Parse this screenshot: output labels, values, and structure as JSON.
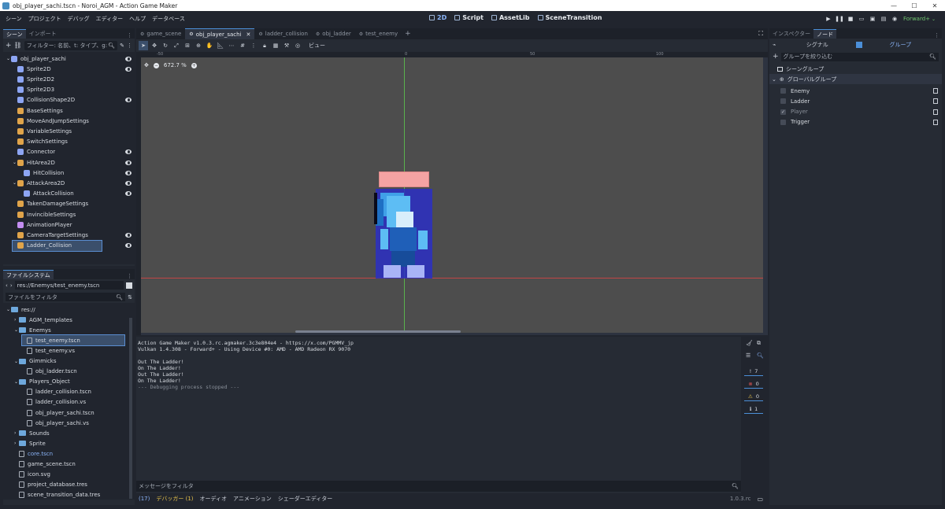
{
  "window": {
    "title": "obj_player_sachi.tscn - Noroi_AGM - Action Game Maker",
    "controls": [
      "—",
      "☐",
      "✕"
    ]
  },
  "menu": [
    "シーン",
    "プロジェクト",
    "デバッグ",
    "エディター",
    "ヘルプ",
    "データベース"
  ],
  "main_tabs": [
    {
      "label": "2D",
      "active": true
    },
    {
      "label": "Script",
      "active": false
    },
    {
      "label": "AssetLib",
      "active": false
    },
    {
      "label": "SceneTransition",
      "active": false
    }
  ],
  "renderer": "Forward+",
  "scene_dock": {
    "tabs": [
      "シーン",
      "インポート"
    ],
    "filter_placeholder": "フィルター: 名前、t: タイプ、g: グ",
    "nodes": [
      {
        "label": "obj_player_sachi",
        "depth": 0,
        "color": "#8da5f3",
        "eye": true,
        "root": true
      },
      {
        "label": "Sprite2D",
        "depth": 1,
        "color": "#8da5f3",
        "eye": true
      },
      {
        "label": "Sprite2D2",
        "depth": 1,
        "color": "#8da5f3",
        "eye": false
      },
      {
        "label": "Sprite2D3",
        "depth": 1,
        "color": "#8da5f3",
        "eye": false
      },
      {
        "label": "CollisionShape2D",
        "depth": 1,
        "color": "#8da5f3",
        "eye": true
      },
      {
        "label": "BaseSettings",
        "depth": 1,
        "color": "#e0a44a",
        "eye": false
      },
      {
        "label": "MoveAndJumpSettings",
        "depth": 1,
        "color": "#e0a44a",
        "eye": false
      },
      {
        "label": "VariableSettings",
        "depth": 1,
        "color": "#e0a44a",
        "eye": false
      },
      {
        "label": "SwitchSettings",
        "depth": 1,
        "color": "#e0a44a",
        "eye": false
      },
      {
        "label": "Connector",
        "depth": 1,
        "color": "#8da5f3",
        "eye": true
      },
      {
        "label": "HitArea2D",
        "depth": 1,
        "color": "#e0a44a",
        "eye": true
      },
      {
        "label": "HitCollision",
        "depth": 2,
        "color": "#8da5f3",
        "eye": true
      },
      {
        "label": "AttackArea2D",
        "depth": 1,
        "color": "#e0a44a",
        "eye": true
      },
      {
        "label": "AttackCollision",
        "depth": 2,
        "color": "#8da5f3",
        "eye": true
      },
      {
        "label": "TakenDamageSettings",
        "depth": 1,
        "color": "#e0a44a",
        "eye": false
      },
      {
        "label": "InvincibleSettings",
        "depth": 1,
        "color": "#e0a44a",
        "eye": false
      },
      {
        "label": "AnimationPlayer",
        "depth": 1,
        "color": "#c38ef1",
        "eye": false
      },
      {
        "label": "CameraTargetSettings",
        "depth": 1,
        "color": "#e0a44a",
        "eye": true
      },
      {
        "label": "Ladder_Collision",
        "depth": 1,
        "color": "#e0a44a",
        "eye": true,
        "selected": true
      }
    ]
  },
  "filesystem": {
    "tab": "ファイルシステム",
    "path": "res://Enemys/test_enemy.tscn",
    "filter_placeholder": "ファイルをフィルタ",
    "items": [
      {
        "label": "res://",
        "depth": 0,
        "kind": "folder"
      },
      {
        "label": "AGM_templates",
        "depth": 1,
        "kind": "folder"
      },
      {
        "label": "Enemys",
        "depth": 1,
        "kind": "folder"
      },
      {
        "label": "test_enemy.tscn",
        "depth": 2,
        "kind": "file",
        "selected": true
      },
      {
        "label": "test_enemy.vs",
        "depth": 2,
        "kind": "file"
      },
      {
        "label": "Gimmicks",
        "depth": 1,
        "kind": "folder"
      },
      {
        "label": "obj_ladder.tscn",
        "depth": 2,
        "kind": "file"
      },
      {
        "label": "Players_Object",
        "depth": 1,
        "kind": "folder"
      },
      {
        "label": "ladder_collision.tscn",
        "depth": 2,
        "kind": "file"
      },
      {
        "label": "ladder_collision.vs",
        "depth": 2,
        "kind": "file"
      },
      {
        "label": "obj_player_sachi.tscn",
        "depth": 2,
        "kind": "file"
      },
      {
        "label": "obj_player_sachi.vs",
        "depth": 2,
        "kind": "file"
      },
      {
        "label": "Sounds",
        "depth": 1,
        "kind": "folder"
      },
      {
        "label": "Sprite",
        "depth": 1,
        "kind": "folder"
      },
      {
        "label": "core.tscn",
        "depth": 1,
        "kind": "file",
        "link": true
      },
      {
        "label": "game_scene.tscn",
        "depth": 1,
        "kind": "file"
      },
      {
        "label": "icon.svg",
        "depth": 1,
        "kind": "file"
      },
      {
        "label": "project_database.tres",
        "depth": 1,
        "kind": "file"
      },
      {
        "label": "scene_transition_data.tres",
        "depth": 1,
        "kind": "file"
      }
    ]
  },
  "scene_tabs": [
    {
      "label": "game_scene",
      "active": false
    },
    {
      "label": "obj_player_sachi",
      "active": true
    },
    {
      "label": "ladder_collision",
      "active": false
    },
    {
      "label": "obj_ladder",
      "active": false
    },
    {
      "label": "test_enemy",
      "active": false
    }
  ],
  "viewport": {
    "toolbar_view_label": "ビュー",
    "zoom": "672.7 %",
    "ruler_labels": [
      "-50",
      "0",
      "50",
      "100"
    ]
  },
  "output": {
    "lines": [
      "Action Game Maker v1.0.3.rc.agmaker.3c3e804e4 - https://x.com/PGMMV_jp",
      "Vulkan 1.4.308 - Forward+ - Using Device #0: AMD - AMD Radeon RX 9070",
      "",
      "Out The Ladder!",
      "On The Ladder!",
      "Out The Ladder!",
      "On The Ladder!",
      "--- Debugging process stopped ---"
    ],
    "filter_placeholder": "メッセージをフィルタ",
    "counts": [
      "7",
      "0",
      "0",
      "1"
    ]
  },
  "bottom_tabs": [
    "(17)",
    "デバッガー (1)",
    "オーディオ",
    "アニメーション",
    "シェーダーエディター"
  ],
  "version": "1.0.3.rc",
  "right_dock": {
    "tabs": [
      "インスペクター",
      "ノード"
    ],
    "subtabs": [
      "シグナル",
      "グループ"
    ],
    "filter_placeholder": "グループを絞り込む",
    "scene_groups_label": "シーングループ",
    "global_groups_label": "グローバルグループ",
    "groups": [
      {
        "label": "Enemy",
        "checked": false
      },
      {
        "label": "Ladder",
        "checked": false
      },
      {
        "label": "Player",
        "checked": true
      },
      {
        "label": "Trigger",
        "checked": false
      }
    ]
  },
  "colors": {
    "accent": "#4b8fd8",
    "viewport_bg": "#4d4d4d",
    "ladder_rect": "#f4a3a3",
    "collision_rect": "#2b2fc4",
    "axis_x": "#c24545",
    "axis_y": "#5ab34d"
  }
}
